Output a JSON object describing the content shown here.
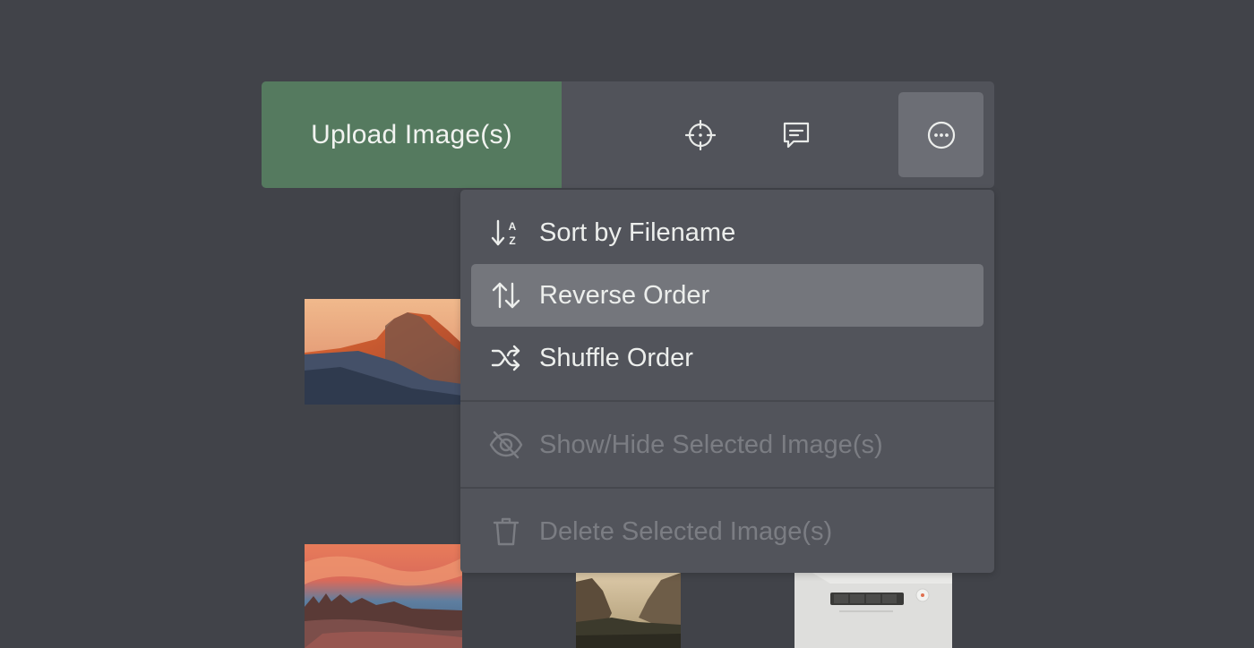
{
  "toolbar": {
    "upload_label": "Upload Image(s)",
    "tools": [
      {
        "icon": "crosshair-icon"
      },
      {
        "icon": "comment-icon"
      },
      {
        "icon": "more-options-icon"
      }
    ]
  },
  "menu": {
    "items": [
      {
        "label": "Sort by Filename",
        "icon": "sort-alpha-icon",
        "state": "enabled"
      },
      {
        "label": "Reverse Order",
        "icon": "reverse-order-icon",
        "state": "highlighted"
      },
      {
        "label": "Shuffle Order",
        "icon": "shuffle-icon",
        "state": "enabled"
      },
      {
        "label": "Show/Hide Selected Image(s)",
        "icon": "eye-slash-icon",
        "state": "disabled"
      },
      {
        "label": "Delete Selected Image(s)",
        "icon": "trash-icon",
        "state": "disabled"
      }
    ]
  },
  "gallery": {
    "thumbnails": [
      {
        "subject": "mountain-sunset-photo"
      },
      {
        "subject": "lake-sunset-photo"
      },
      {
        "subject": "valley-photo"
      },
      {
        "subject": "device-photo"
      }
    ]
  },
  "colors": {
    "background": "#414349",
    "toolbar": "#51535a",
    "upload_button": "#557a5f",
    "menu": "#52545b",
    "menu_highlight": "#74767c",
    "menu_text": "#eceeec",
    "menu_text_disabled": "#7b7d83"
  }
}
